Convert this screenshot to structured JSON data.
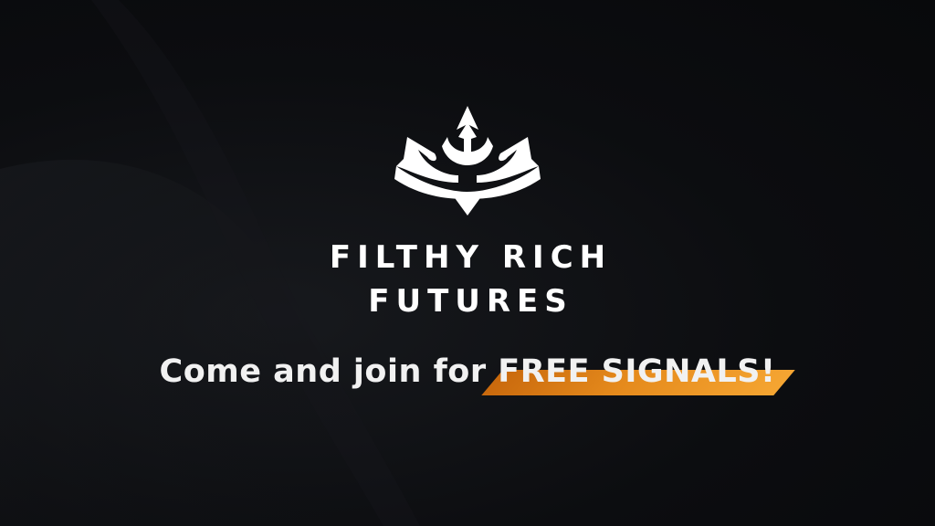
{
  "brand": {
    "line1": "FILTHY RICH",
    "line2": "FUTURES",
    "logo_icon": "crown-icon"
  },
  "tagline": {
    "prefix": "Come and join for ",
    "highlight": "FREE SIGNALS!"
  },
  "colors": {
    "background": "#0b0c0e",
    "text": "#ffffff",
    "accent": "#e58a1c"
  }
}
